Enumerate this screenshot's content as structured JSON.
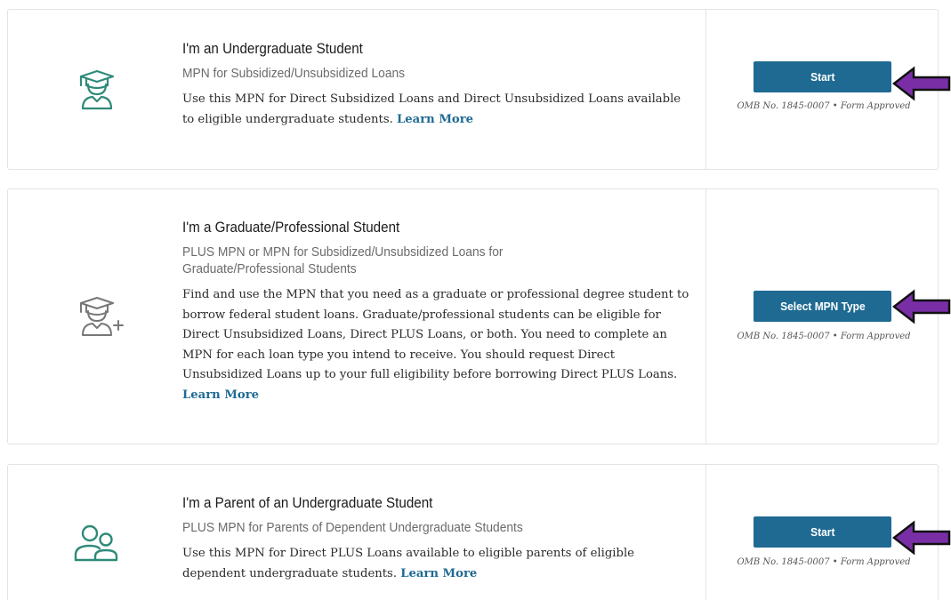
{
  "colors": {
    "accent": "#1f6a93",
    "icon": "#2f8a7a",
    "arrow_fill": "#7a2ea6",
    "arrow_stroke": "#111111",
    "border": "#e3e3e3"
  },
  "cards": [
    {
      "icon": "graduate-cap-icon",
      "title": "I'm an Undergraduate Student",
      "subtitle": "MPN for Subsidized/Unsubsidized Loans",
      "description": "Use this MPN for Direct Subsidized Loans and Direct Unsubsidized Loans available to eligible undergraduate students.",
      "learn_more": "Learn More",
      "button": "Start",
      "omb": "OMB No. 1845-0007  •  Form Approved"
    },
    {
      "icon": "graduate-plus-icon",
      "title": "I'm a Graduate/Professional Student",
      "subtitle": "PLUS MPN or MPN for Subsidized/Unsubsidized Loans for Graduate/Professional Students",
      "description": "Find and use the MPN that you need as a graduate or professional degree student to borrow federal student loans. Graduate/professional students can be eligible for Direct Unsubsidized Loans, Direct PLUS Loans, or both. You need to complete an MPN for each loan type you intend to receive. You should request Direct Unsubsidized Loans up to your full eligibility before borrowing Direct PLUS Loans.",
      "learn_more": "Learn More",
      "button": "Select MPN Type",
      "omb": "OMB No. 1845-0007  •  Form Approved"
    },
    {
      "icon": "parent-child-icon",
      "title": "I'm a Parent of an Undergraduate Student",
      "subtitle": "PLUS MPN for Parents of Dependent Undergraduate Students",
      "description": "Use this MPN for Direct PLUS Loans available to eligible parents of eligible dependent undergraduate students.",
      "learn_more": "Learn More",
      "button": "Start",
      "omb": "OMB No. 1845-0007  •  Form Approved"
    }
  ],
  "annotations": [
    "arrow-left-icon",
    "arrow-left-icon",
    "arrow-left-icon"
  ]
}
